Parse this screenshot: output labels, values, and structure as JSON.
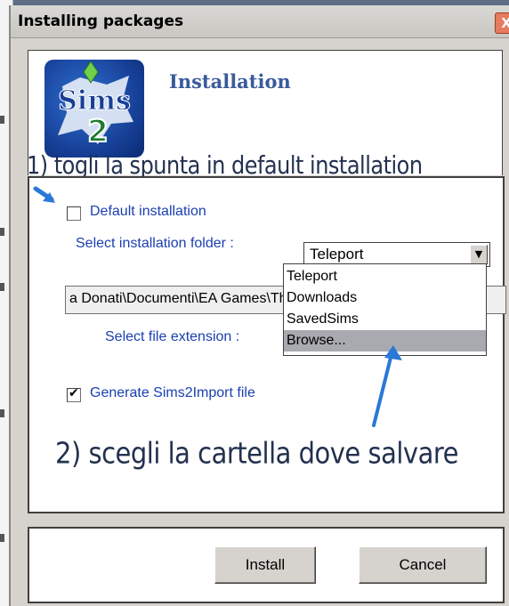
{
  "window": {
    "title": "Installing packages",
    "close_label": "X"
  },
  "header": {
    "title": "Installation",
    "logo_icon": "the-sims-2-logo"
  },
  "annotations": {
    "note1": "1) togli la spunta in default installation",
    "note2": "2) scegli la cartella dove salvare"
  },
  "form": {
    "default_installation_label": "Default installation",
    "default_installation_checked": false,
    "select_folder_label": "Select installation folder :",
    "selected_folder": "Teleport",
    "path_value": "a Donati\\Documenti\\EA Games\\The Sims 2\\Teleport",
    "select_extension_label": "Select file extension :",
    "generate_label": "Generate Sims2Import file",
    "generate_checked": true
  },
  "dropdown": {
    "options": [
      "Teleport",
      "Downloads",
      "SavedSims",
      "Browse..."
    ],
    "highlighted_option": "Browse..."
  },
  "buttons": {
    "install": "Install",
    "cancel": "Cancel"
  },
  "colors": {
    "label_blue": "#1a3fb0",
    "header_blue": "#3a5a9a",
    "annotation_arrow": "#2a78d8",
    "highlight": "#a9a9b0"
  }
}
